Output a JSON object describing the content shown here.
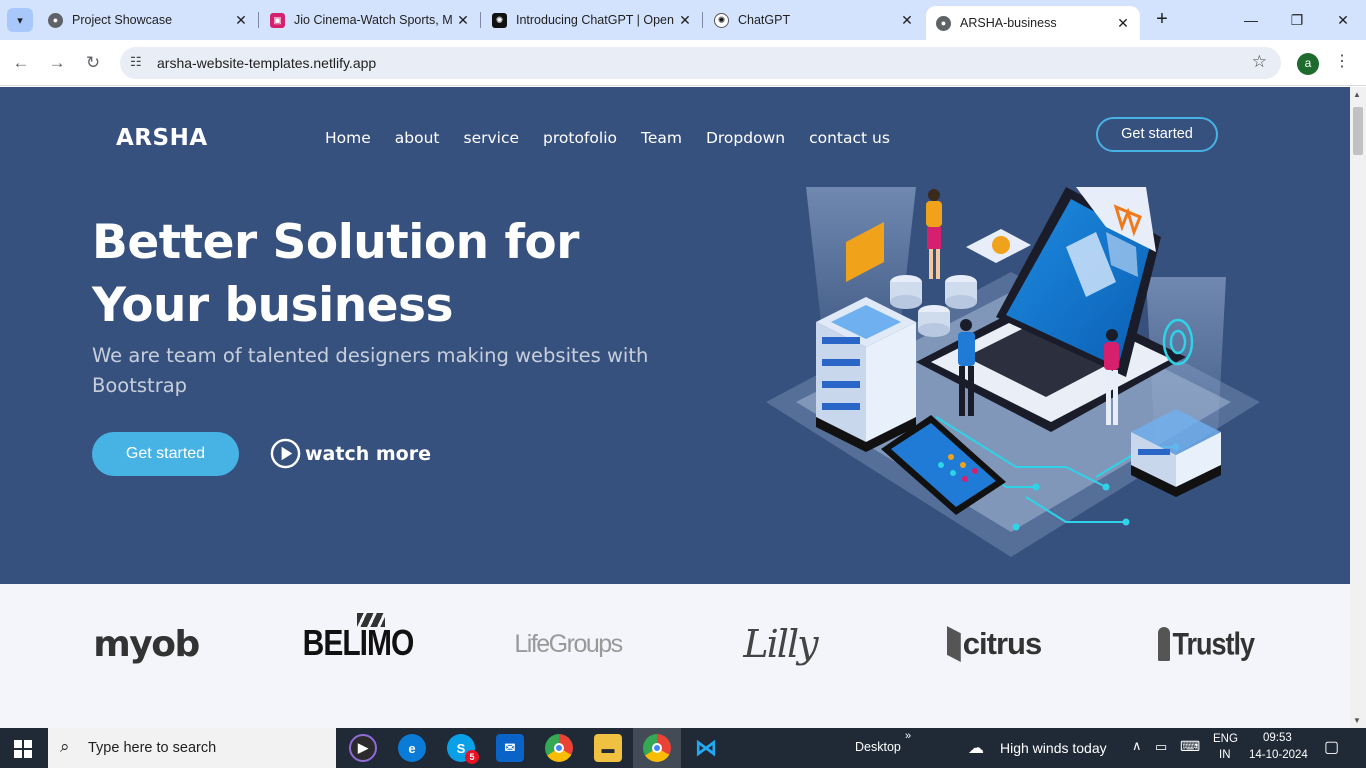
{
  "browser": {
    "tabs": [
      {
        "title": "Project Showcase",
        "favicon": "globe-icon"
      },
      {
        "title": "Jio Cinema-Watch Sports, M",
        "favicon": "jiocinema-icon"
      },
      {
        "title": "Introducing ChatGPT | Open",
        "favicon": "openai-icon"
      },
      {
        "title": "ChatGPT",
        "favicon": "openai-icon"
      },
      {
        "title": "ARSHA-business",
        "favicon": "globe-icon",
        "active": true
      }
    ],
    "url": "arsha-website-templates.netlify.app",
    "profile_initial": "a"
  },
  "site": {
    "logo": "ARSHA",
    "nav": [
      "Home",
      "about",
      "service",
      "protofolio",
      "Team",
      "Dropdown",
      "contact us"
    ],
    "header_cta": "Get started",
    "hero_title_line1": "Better Solution for",
    "hero_title_line2": "Your business",
    "hero_subtitle": "We are team of talented designers making websites with Bootstrap",
    "hero_cta": "Get started",
    "watch_more": "watch more",
    "clients": [
      "myob",
      "BELIMO",
      "LifeGroups",
      "Lilly",
      "citrus",
      "Trustly"
    ],
    "colors": {
      "hero_bg": "#37517e",
      "accent": "#47b2e4",
      "clients_bg": "#f3f5fa"
    }
  },
  "taskbar": {
    "search_placeholder": "Type here to search",
    "desktop_label": "Desktop",
    "weather": "High winds today",
    "lang_line1": "ENG",
    "lang_line2": "IN",
    "time": "09:53",
    "date": "14-10-2024",
    "skype_badge": "5"
  }
}
